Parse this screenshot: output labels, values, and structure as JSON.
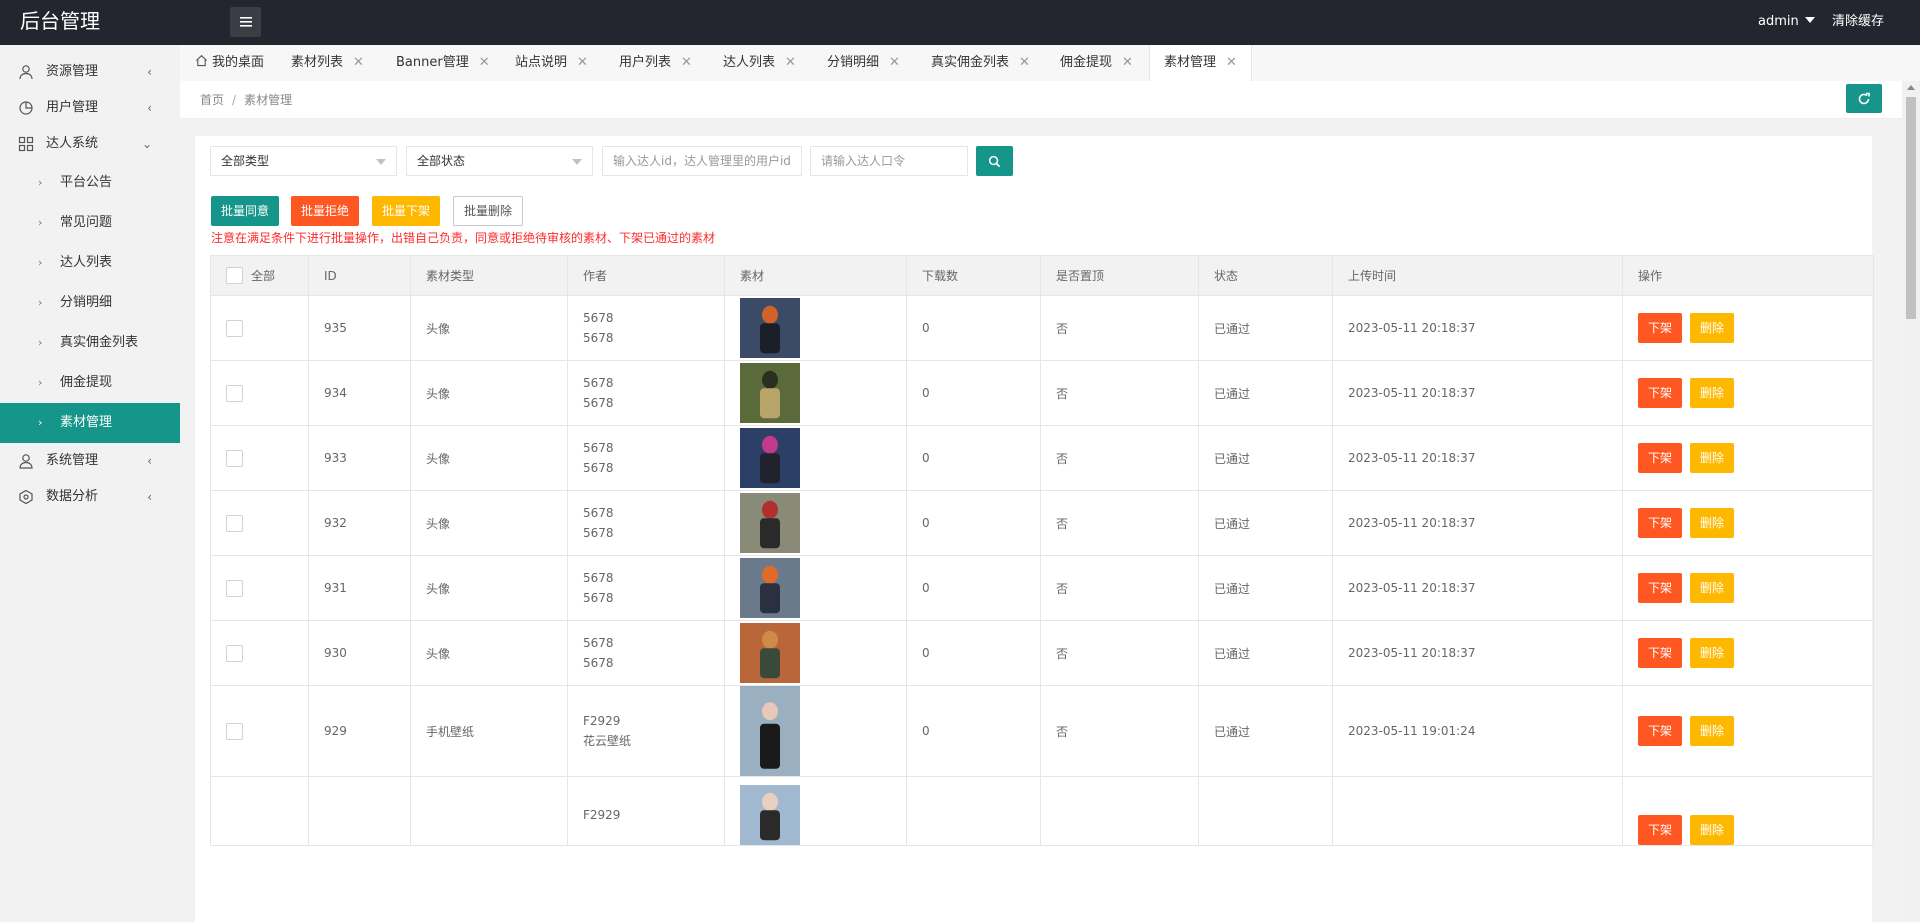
{
  "header": {
    "logo": "后台管理",
    "user": "admin",
    "clear_cache": "清除缓存"
  },
  "sidebar": {
    "items": [
      {
        "label": "资源管理",
        "icon": "user-icon",
        "arrow": "‹"
      },
      {
        "label": "用户管理",
        "icon": "chart-icon",
        "arrow": "‹"
      },
      {
        "label": "达人系统",
        "icon": "grid-icon",
        "arrow": "⌄"
      }
    ],
    "subitems": [
      {
        "label": "平台公告"
      },
      {
        "label": "常见问题"
      },
      {
        "label": "达人列表"
      },
      {
        "label": "分销明细"
      },
      {
        "label": "真实佣金列表"
      },
      {
        "label": "佣金提现"
      },
      {
        "label": "素材管理",
        "active": true
      }
    ],
    "bottom_items": [
      {
        "label": "系统管理",
        "icon": "system-user-icon",
        "arrow": "‹"
      },
      {
        "label": "数据分析",
        "icon": "analysis-icon",
        "arrow": "‹"
      }
    ]
  },
  "tabs": [
    {
      "label": "我的桌面",
      "icon": "home-icon"
    },
    {
      "label": "素材列表",
      "close": "✕"
    },
    {
      "label": "Banner管理",
      "close": "✕"
    },
    {
      "label": "站点说明",
      "close": "✕"
    },
    {
      "label": "用户列表",
      "close": "✕"
    },
    {
      "label": "达人列表",
      "close": "✕"
    },
    {
      "label": "分销明细",
      "close": "✕"
    },
    {
      "label": "真实佣金列表",
      "close": "✕"
    },
    {
      "label": "佣金提现",
      "close": "✕"
    },
    {
      "label": "素材管理",
      "close": "✕",
      "active": true
    }
  ],
  "breadcrumb": {
    "home": "首页",
    "sep": "/",
    "current": "素材管理"
  },
  "filters": {
    "type_select": "全部类型",
    "status_select": "全部状态",
    "user_placeholder": "输入达人id，达人管理里的用户id",
    "code_placeholder": "请输入达人口令"
  },
  "actions": {
    "approve": "批量同意",
    "reject": "批量拒绝",
    "offline": "批量下架",
    "delete": "批量删除"
  },
  "warning": "注意在满足条件下进行批量操作，出错自己负责，同意或拒绝待审核的素材、下架已通过的素材",
  "table": {
    "headers": [
      "全部",
      "ID",
      "素材类型",
      "作者",
      "素材",
      "下载数",
      "是否置顶",
      "状态",
      "上传时间",
      "操作"
    ],
    "rows": [
      {
        "id": "935",
        "type": "头像",
        "author1": "5678",
        "author2": "5678",
        "downloads": "0",
        "pinned": "否",
        "status": "已通过",
        "time": "2023-05-11 20:18:37",
        "img": "c1"
      },
      {
        "id": "934",
        "type": "头像",
        "author1": "5678",
        "author2": "5678",
        "downloads": "0",
        "pinned": "否",
        "status": "已通过",
        "time": "2023-05-11 20:18:37",
        "img": "c2"
      },
      {
        "id": "933",
        "type": "头像",
        "author1": "5678",
        "author2": "5678",
        "downloads": "0",
        "pinned": "否",
        "status": "已通过",
        "time": "2023-05-11 20:18:37",
        "img": "c3"
      },
      {
        "id": "932",
        "type": "头像",
        "author1": "5678",
        "author2": "5678",
        "downloads": "0",
        "pinned": "否",
        "status": "已通过",
        "time": "2023-05-11 20:18:37",
        "img": "c4"
      },
      {
        "id": "931",
        "type": "头像",
        "author1": "5678",
        "author2": "5678",
        "downloads": "0",
        "pinned": "否",
        "status": "已通过",
        "time": "2023-05-11 20:18:37",
        "img": "c5"
      },
      {
        "id": "930",
        "type": "头像",
        "author1": "5678",
        "author2": "5678",
        "downloads": "0",
        "pinned": "否",
        "status": "已通过",
        "time": "2023-05-11 20:18:37",
        "img": "c6"
      },
      {
        "id": "929",
        "type": "手机壁纸",
        "author1": "F2929",
        "author2": "花云壁纸",
        "downloads": "0",
        "pinned": "否",
        "status": "已通过",
        "time": "2023-05-11 19:01:24",
        "img": "c7"
      },
      {
        "id": "",
        "type": "",
        "author1": "F2929",
        "author2": "",
        "downloads": "",
        "pinned": "",
        "status": "",
        "time": "",
        "img": "c8"
      }
    ],
    "op_offline": "下架",
    "op_delete": "删除"
  },
  "colors": {
    "accent": "#16968a",
    "danger": "#ff5722",
    "warning": "#ffb800",
    "header_bg": "#23262e"
  }
}
